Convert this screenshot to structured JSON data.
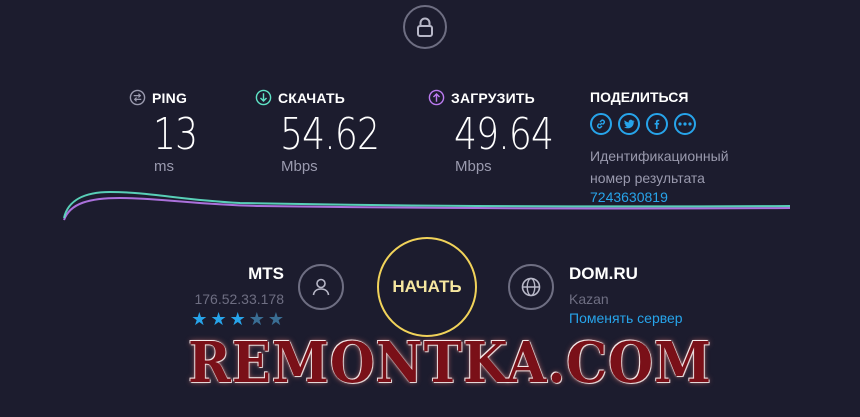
{
  "top": {
    "lock_icon": "lock-icon"
  },
  "metrics": {
    "ping": {
      "label": "PING",
      "value": "13",
      "unit": "ms",
      "icon": "ping-icon",
      "color": "#9a9aae"
    },
    "download": {
      "label": "СКАЧАТЬ",
      "value": "54.62",
      "unit": "Mbps",
      "icon": "download-icon",
      "color": "#5fe3c6"
    },
    "upload": {
      "label": "ЗАГРУЗИТЬ",
      "value": "49.64",
      "unit": "Mbps",
      "icon": "upload-icon",
      "color": "#bb7bf0"
    }
  },
  "share": {
    "title": "ПОДЕЛИТЬСЯ",
    "icons": [
      "link-icon",
      "twitter-icon",
      "facebook-icon",
      "more-icon"
    ],
    "result_label_1": "Идентификационный",
    "result_label_2": "номер результата",
    "result_id": "7243630819"
  },
  "isp": {
    "name": "MTS",
    "ip": "176.52.33.178",
    "rating": 3,
    "rating_max": 5,
    "icon": "user-icon"
  },
  "go_button": {
    "label": "НАЧАТЬ"
  },
  "server": {
    "name": "DOM.RU",
    "city": "Kazan",
    "change_label": "Поменять сервер",
    "icon": "globe-icon"
  },
  "watermark": {
    "text": "REMONTKA.COM"
  },
  "colors": {
    "background": "#1c1c2e",
    "accent": "#27a4ea",
    "go_ring": "#f1d35a",
    "download_line": "#5fe3c6",
    "upload_line": "#bb7bf0"
  }
}
